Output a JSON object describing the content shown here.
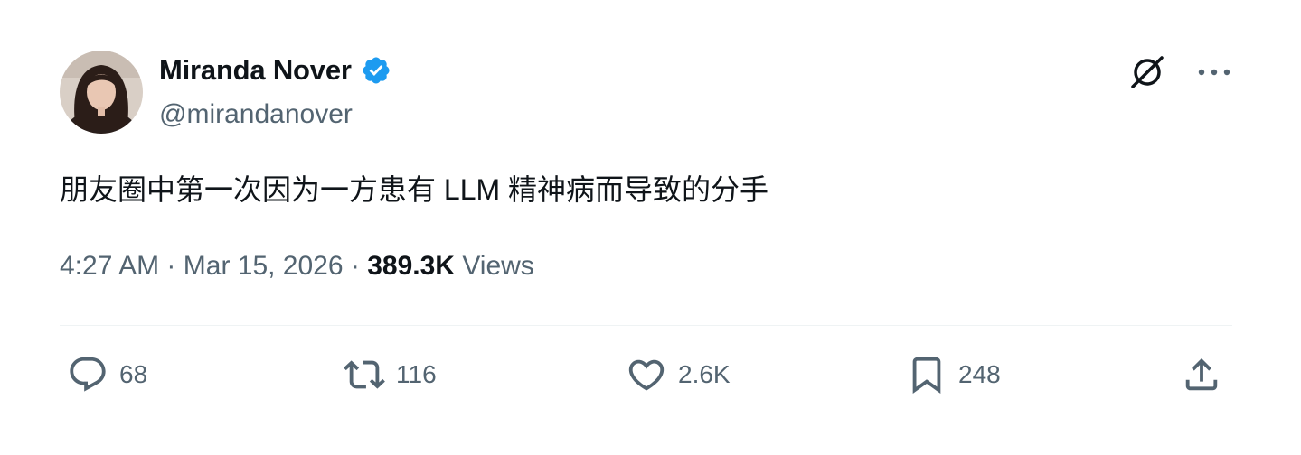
{
  "author": {
    "display_name": "Miranda Nover",
    "handle": "@mirandanover",
    "verified": true
  },
  "tweet": {
    "text": "朋友圈中第一次因为一方患有 LLM 精神病而导致的分手",
    "time": "4:27 AM",
    "separator": "·",
    "date": "Mar 15, 2026",
    "views_count": "389.3K",
    "views_label": "Views"
  },
  "top_icons": [
    "grok-icon",
    "more-options-icon"
  ],
  "actions": {
    "reply_count": "68",
    "retweet_count": "116",
    "like_count": "2.6K",
    "bookmark_count": "248"
  },
  "colors": {
    "text_primary": "#0f1419",
    "text_secondary": "#536471",
    "verified_blue": "#1d9bf0",
    "divider": "#eff3f4"
  }
}
